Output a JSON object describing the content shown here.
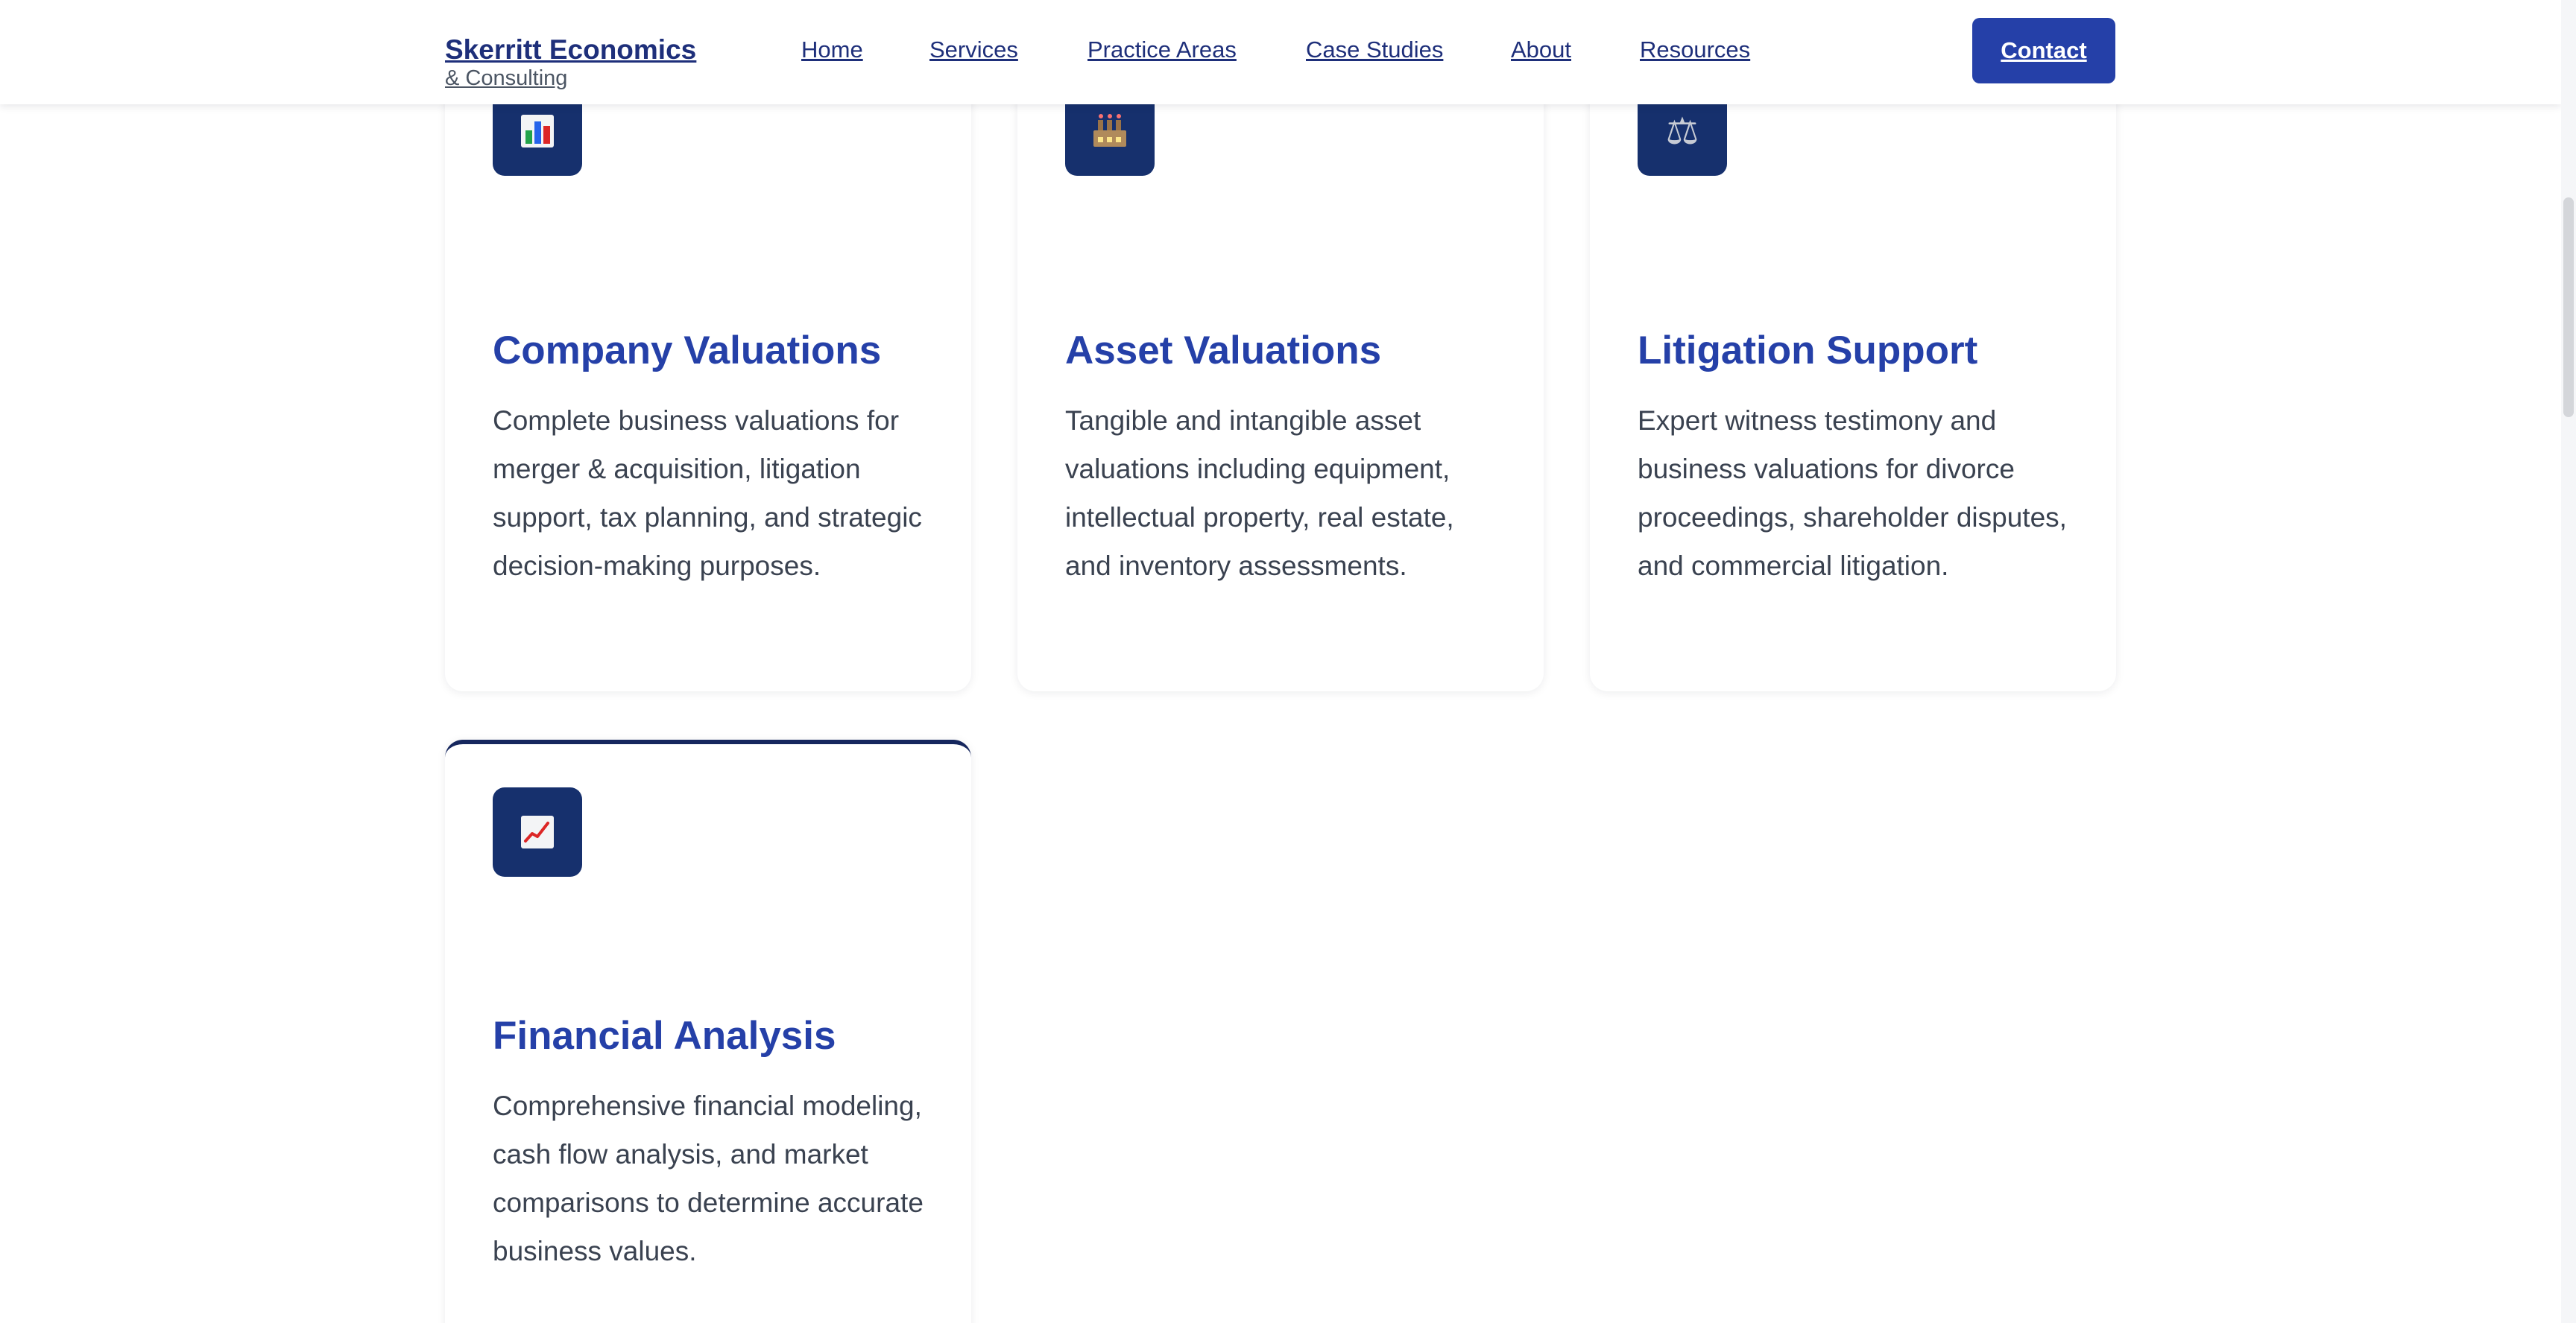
{
  "header": {
    "brand_name": "Skerritt Economics",
    "brand_sub": "& Consulting",
    "nav": [
      "Home",
      "Services",
      "Practice Areas",
      "Case Studies",
      "About",
      "Resources"
    ],
    "contact_label": "Contact"
  },
  "colors": {
    "brand": "#1e2f7a",
    "accent": "#2540a8",
    "icon_tile": "#16306d",
    "body_text": "#3a4250"
  },
  "cards": [
    {
      "icon": "bar-chart-icon",
      "title": "Company Valuations",
      "description": "Complete business valuations for merger & acquisition, litigation support, tax planning, and strategic decision-making purposes."
    },
    {
      "icon": "factory-icon",
      "title": "Asset Valuations",
      "description": "Tangible and intangible asset valuations including equipment, intellectual property, real estate, and inventory assessments."
    },
    {
      "icon": "scales-icon",
      "title": "Litigation Support",
      "description": "Expert witness testimony and business valuations for divorce proceedings, shareholder disputes, and commercial litigation."
    },
    {
      "icon": "trending-up-icon",
      "title": "Financial Analysis",
      "description": "Comprehensive financial modeling, cash flow analysis, and market comparisons to determine accurate business values."
    }
  ]
}
